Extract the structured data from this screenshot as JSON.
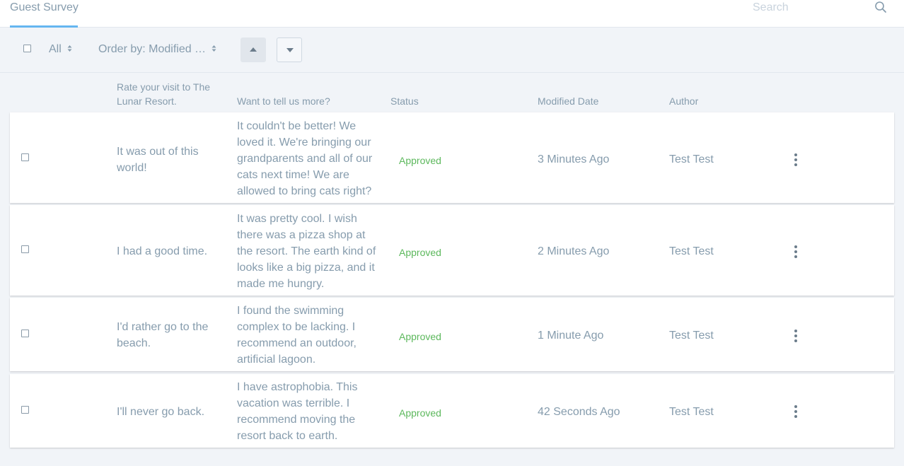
{
  "nav": {
    "tab_label": "Guest Survey",
    "search_placeholder": "Search"
  },
  "toolbar": {
    "filter_label": "All",
    "order_label": "Order by: Modified …"
  },
  "columns": {
    "rating": "Rate your visit to The Lunar Resort.",
    "comment": "Want to tell us more?",
    "status": "Status",
    "modified": "Modified Date",
    "author": "Author"
  },
  "rows": [
    {
      "rating": "It was out of this world!",
      "comment": "It couldn't be better! We loved it. We're bringing our grandparents and all of our cats next time! We are allowed to bring cats right?",
      "status": "Approved",
      "modified": "3 Minutes Ago",
      "author": "Test Test"
    },
    {
      "rating": "I had a good time.",
      "comment": "It was pretty cool. I wish there was a pizza shop at the resort. The earth kind of looks like a big pizza, and it made me hungry.",
      "status": "Approved",
      "modified": "2 Minutes Ago",
      "author": "Test Test"
    },
    {
      "rating": "I'd rather go to the beach.",
      "comment": "I found the swimming complex to be lacking. I recommend an outdoor, artificial lagoon.",
      "status": "Approved",
      "modified": "1 Minute Ago",
      "author": "Test Test"
    },
    {
      "rating": "I'll never go back.",
      "comment": "I have astrophobia. This vacation was terrible. I recommend moving the resort back to earth.",
      "status": "Approved",
      "modified": "42 Seconds Ago",
      "author": "Test Test"
    }
  ],
  "colors": {
    "approved": "#5cb85c",
    "accent": "#65b6f0"
  }
}
